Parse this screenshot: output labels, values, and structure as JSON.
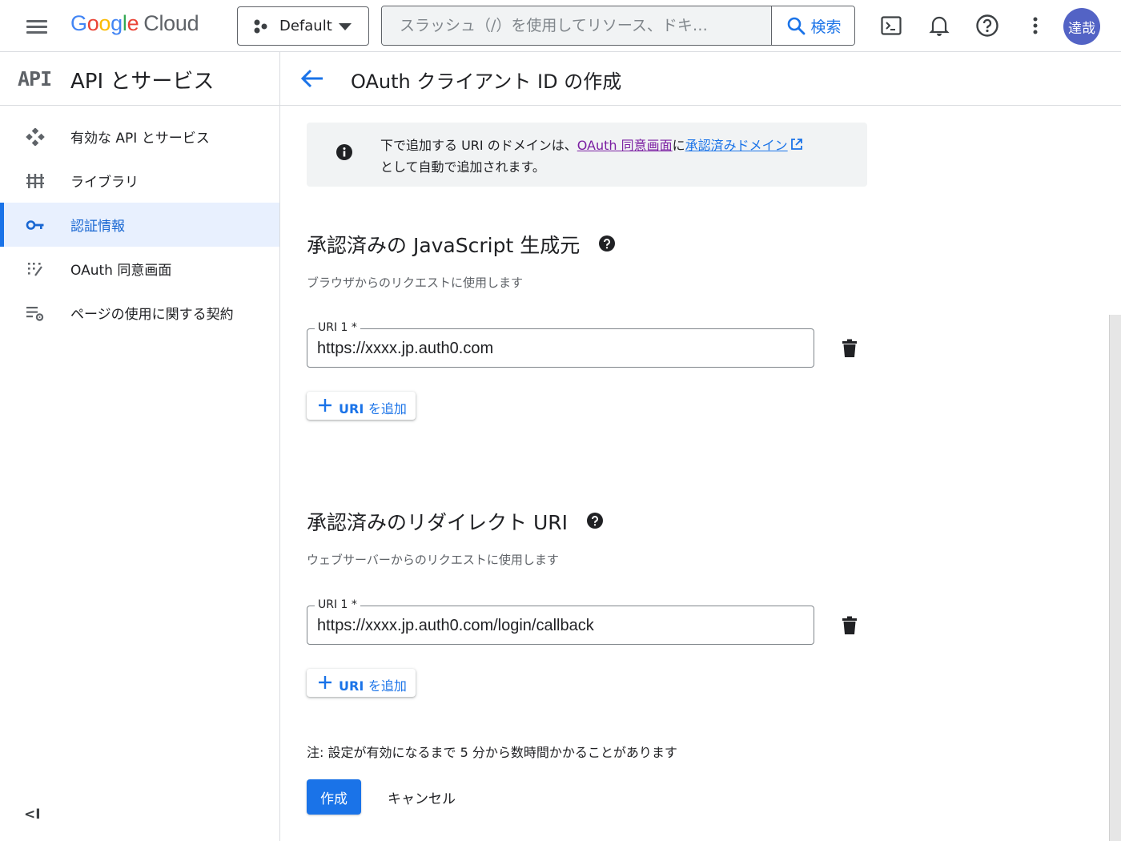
{
  "topbar": {
    "logo_google": "Google",
    "logo_cloud": "Cloud",
    "project_name": "Default",
    "search_placeholder": "スラッシュ（/）を使用してリソース、ドキ…",
    "search_button": "検索",
    "avatar_text": "達哉"
  },
  "sidebar": {
    "badge": "API",
    "title": "API とサービス",
    "items": [
      {
        "label": "有効な API とサービス",
        "icon": "diamond-dots-icon",
        "active": false
      },
      {
        "label": "ライブラリ",
        "icon": "library-icon",
        "active": false
      },
      {
        "label": "認証情報",
        "icon": "key-icon",
        "active": true
      },
      {
        "label": "OAuth 同意画面",
        "icon": "consent-grid-icon",
        "active": false
      },
      {
        "label": "ページの使用に関する契約",
        "icon": "settings-list-icon",
        "active": false
      }
    ],
    "collapse_label": "<I"
  },
  "main": {
    "title": "OAuth クライアント ID の作成",
    "info": {
      "text_before": "下で追加する URI のドメインは、",
      "link1": "OAuth 同意画面",
      "text_mid": "に",
      "link2": "承認済みドメイン",
      "text_after": "として自動で追加されます。"
    },
    "js_origins": {
      "heading": "承認済みの JavaScript 生成元",
      "description": "ブラウザからのリクエストに使用します",
      "field_label": "URI 1 *",
      "field_value": "https://xxxx.jp.auth0.com",
      "add_uri_bold": "URI",
      "add_uri_rest": "を追加"
    },
    "redirect_uris": {
      "heading": "承認済みのリダイレクト URI",
      "description": "ウェブサーバーからのリクエストに使用します",
      "field_label": "URI 1 *",
      "field_value": "https://xxxx.jp.auth0.com/login/callback",
      "add_uri_bold": "URI",
      "add_uri_rest": "を追加"
    },
    "note": "注: 設定が有効になるまで 5 分から数時間かかることがあります",
    "create_button": "作成",
    "cancel_button": "キャンセル"
  },
  "colors": {
    "accent": "#1a73e8",
    "active_bg": "#e8f0fe",
    "visited_link": "#7b1fa2",
    "avatar_bg": "#5363c5"
  }
}
